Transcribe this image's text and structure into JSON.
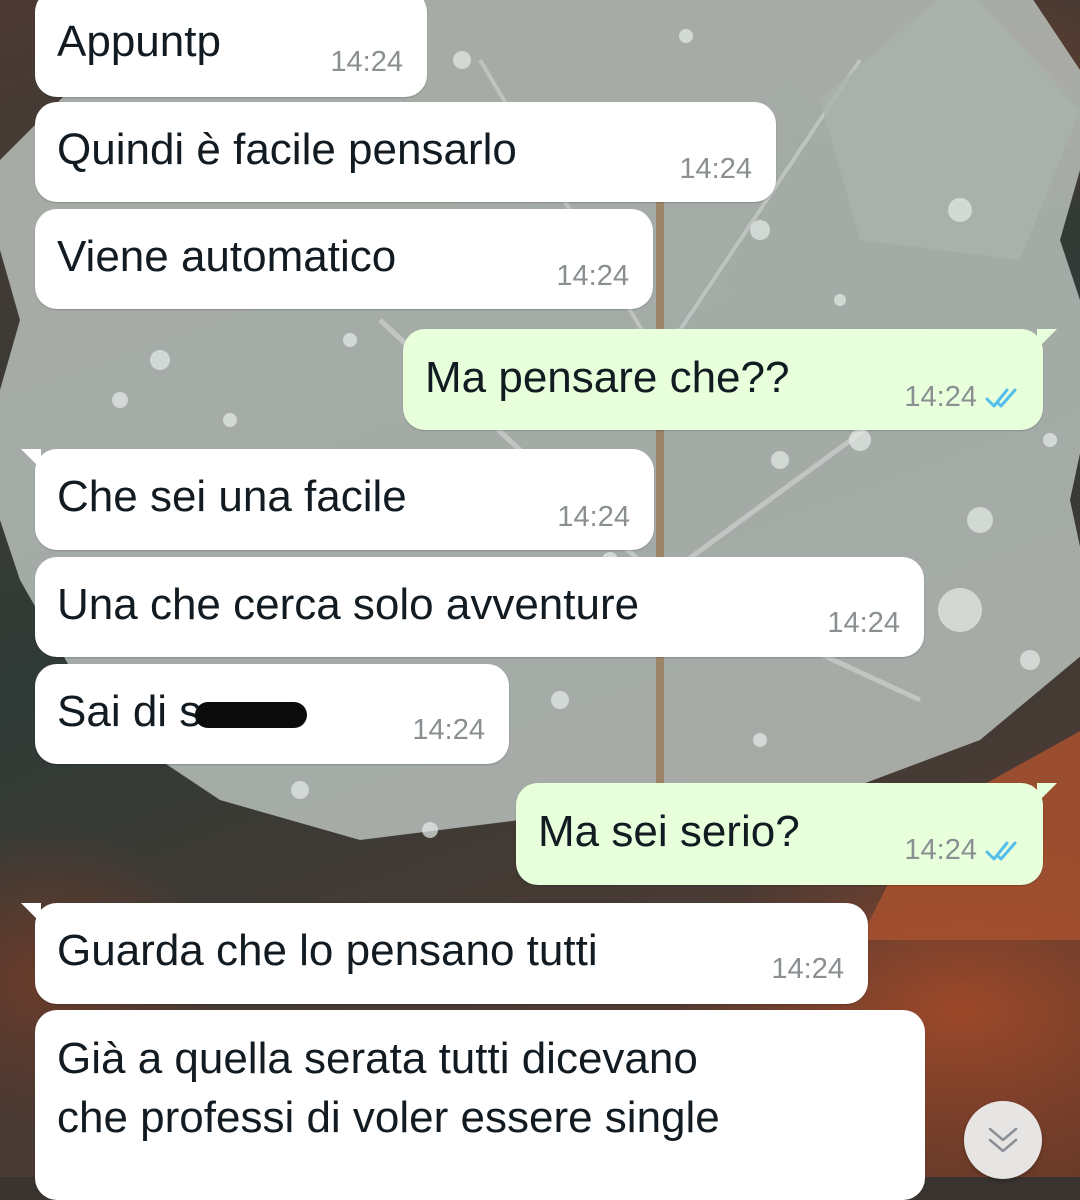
{
  "chat": {
    "messages": [
      {
        "direction": "in",
        "text": "Appuntp",
        "time": "14:24"
      },
      {
        "direction": "in",
        "text": "Quindi è facile pensarlo",
        "time": "14:24"
      },
      {
        "direction": "in",
        "text": "Viene automatico",
        "time": "14:24"
      },
      {
        "direction": "out",
        "text": "Ma pensare che??",
        "time": "14:24",
        "status": "read"
      },
      {
        "direction": "in",
        "text": "Che sei una facile",
        "time": "14:24"
      },
      {
        "direction": "in",
        "text": "Una che cerca solo avventure",
        "time": "14:24"
      },
      {
        "direction": "in",
        "text": "Sai di s",
        "time": "14:24",
        "redacted": true
      },
      {
        "direction": "out",
        "text": "Ma sei serio?",
        "time": "14:24",
        "status": "read"
      },
      {
        "direction": "in",
        "text": "Guarda che lo pensano tutti",
        "time": "14:24"
      },
      {
        "direction": "in",
        "lines": [
          "Già a quella serata tutti dicevano",
          "che professi di voler essere single"
        ]
      }
    ]
  },
  "icons": {
    "read_receipt": "double-check-icon",
    "scroll_down": "double-chevron-down-icon"
  },
  "colors": {
    "incoming_bubble": "#ffffff",
    "outgoing_bubble": "#e7ffdb",
    "timestamp": "#8a8f92",
    "read_tick": "#53bdeb",
    "text": "#111b21"
  }
}
